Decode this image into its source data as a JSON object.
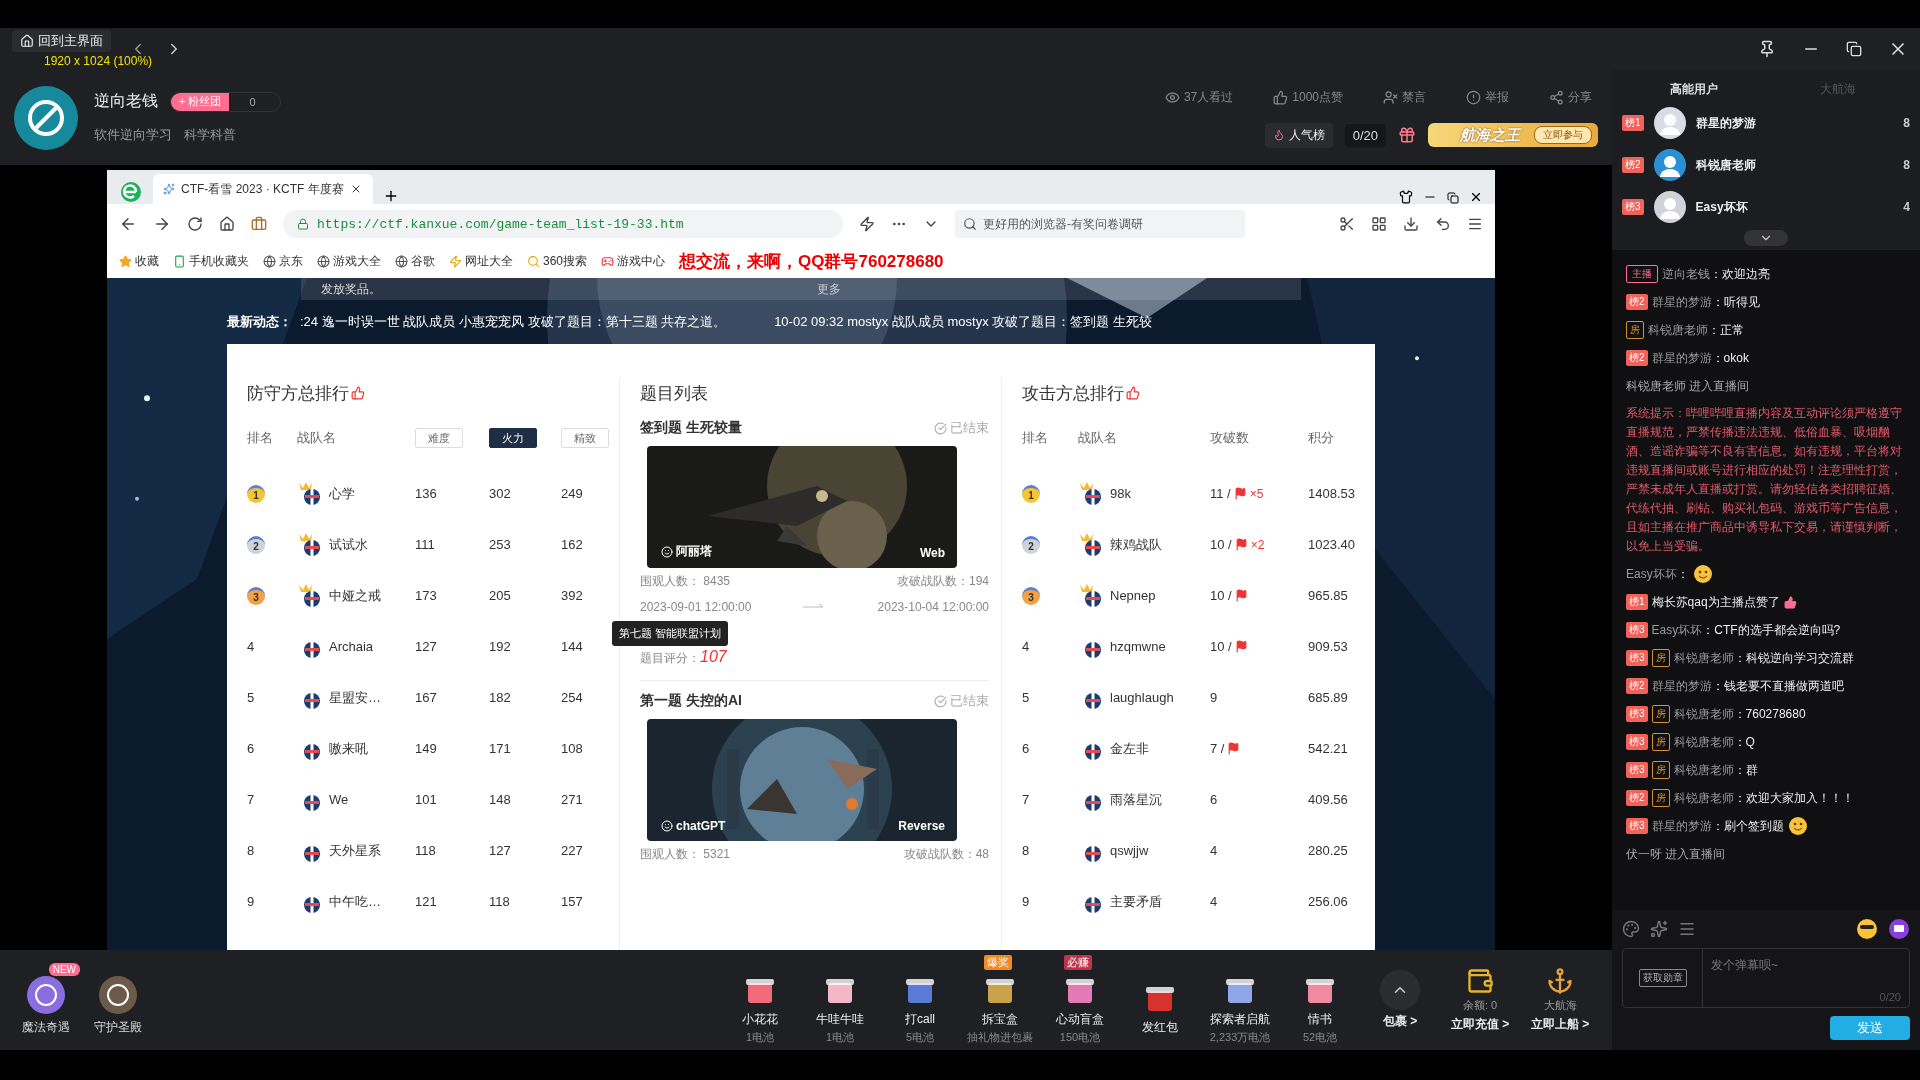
{
  "window": {
    "home_button": "回到主界面",
    "resolution_overlay": "1920 x 1024 (100%)"
  },
  "streamer": {
    "name": "逆向老钱",
    "fan_club": "+ 粉丝团",
    "fan_count": "0",
    "tags": [
      "软件逆向学习",
      "科学科普"
    ],
    "stats": [
      {
        "kind": "views",
        "label": "37人看过"
      },
      {
        "kind": "likes",
        "label": "1000点赞"
      },
      {
        "kind": "mute",
        "label": "禁言"
      },
      {
        "kind": "report",
        "label": "举报"
      },
      {
        "kind": "share",
        "label": "分享"
      }
    ],
    "popularity": "人气榜",
    "progress": "0/20",
    "banner": {
      "title": "航海之王",
      "button": "立即参与"
    }
  },
  "browser": {
    "tab": "CTF-看雪 2023 · KCTF 年度赛",
    "url": "https://ctf.kanxue.com/game-team_list-19-33.htm",
    "search_placeholder": "更好用的浏览器-有奖问卷调研",
    "bookmarks": [
      {
        "kind": "star",
        "label": "收藏"
      },
      {
        "kind": "phone",
        "label": "手机收藏夹"
      },
      {
        "kind": "globe",
        "label": "京东"
      },
      {
        "kind": "globe",
        "label": "游戏大全"
      },
      {
        "kind": "globe",
        "label": "谷歌"
      },
      {
        "kind": "site",
        "label": "网址大全"
      },
      {
        "kind": "search",
        "label": "360搜索"
      },
      {
        "kind": "game",
        "label": "游戏中心"
      }
    ],
    "overlay_text": "想交流，来啊，QQ群号760278680"
  },
  "page": {
    "notice": "发放奖品。",
    "more": "更多",
    "ticker_label": "最新动态：",
    "ticker": [
      ":24 逸一时误一世 战队成员 小惠宠宠风 攻破了题目：第十三题 共存之道。",
      "10-02 09:32 mostyx 战队成员 mostyx 攻破了题目：签到题 生死较"
    ],
    "defense": {
      "title": "防守方总排行",
      "columns": [
        "排名",
        "战队名"
      ],
      "sorts": [
        {
          "label": "难度",
          "selected": false
        },
        {
          "label": "火力",
          "selected": true
        },
        {
          "label": "精致",
          "selected": false
        }
      ],
      "rows": [
        {
          "rank": "1",
          "color": "#f7c531",
          "team": "心学",
          "values": [
            "136",
            "302",
            "249"
          ]
        },
        {
          "rank": "2",
          "color": "#cfd2d6",
          "team": "试试水",
          "values": [
            "111",
            "253",
            "162"
          ]
        },
        {
          "rank": "3",
          "color": "#f4a045",
          "team": "中娅之戒",
          "values": [
            "173",
            "205",
            "392"
          ]
        },
        {
          "rank": "4",
          "team": "Archaia",
          "values": [
            "127",
            "192",
            "144"
          ]
        },
        {
          "rank": "5",
          "team": "星盟安…",
          "values": [
            "167",
            "182",
            "254"
          ]
        },
        {
          "rank": "6",
          "team": "嗷来吼",
          "values": [
            "149",
            "171",
            "108"
          ]
        },
        {
          "rank": "7",
          "team": "We",
          "values": [
            "101",
            "148",
            "271"
          ]
        },
        {
          "rank": "8",
          "team": "天外星系",
          "values": [
            "118",
            "127",
            "227"
          ]
        },
        {
          "rank": "9",
          "team": "中午吃…",
          "values": [
            "121",
            "118",
            "157"
          ]
        }
      ]
    },
    "problems": {
      "title": "题目列表",
      "items": [
        {
          "title": "签到题 生死较量",
          "status": "已结束",
          "author": "阿丽塔",
          "category": "Web",
          "viewers_label": "围观人数：",
          "viewers": "8435",
          "solved_label": "攻破战队数：",
          "solved": "194",
          "start": "2023-09-01 12:00:00",
          "end": "2023-10-04 12:00:00",
          "score_label": "题目评分：",
          "score": "107"
        },
        {
          "title": "第一题 失控的AI",
          "status": "已结束",
          "author": "chatGPT",
          "category": "Reverse",
          "viewers_label": "围观人数：",
          "viewers": "5321",
          "solved_label": "攻破战队数：",
          "solved": "48"
        }
      ]
    },
    "tooltip": "第七题 智能联盟计划",
    "attack": {
      "title": "攻击方总排行",
      "columns": [
        "排名",
        "战队名",
        "攻破数",
        "积分"
      ],
      "rows": [
        {
          "rank": "1",
          "color": "#f7c531",
          "team": "98k",
          "solved": "11 /",
          "flag": true,
          "flag_count": "×5",
          "points": "1408.53"
        },
        {
          "rank": "2",
          "color": "#cfd2d6",
          "team": "辣鸡战队",
          "solved": "10 /",
          "flag": true,
          "flag_count": "×2",
          "points": "1023.40"
        },
        {
          "rank": "3",
          "color": "#f4a045",
          "team": "Nepnep",
          "solved": "10 /",
          "flag": true,
          "points": "965.85"
        },
        {
          "rank": "4",
          "team": "hzqmwne",
          "solved": "10 /",
          "flag": true,
          "points": "909.53"
        },
        {
          "rank": "5",
          "team": "laughlaugh",
          "solved": "9",
          "flag": false,
          "points": "685.89"
        },
        {
          "rank": "6",
          "team": "金左非",
          "solved": "7 /",
          "flag": true,
          "points": "542.21"
        },
        {
          "rank": "7",
          "team": "雨落星沉",
          "solved": "6",
          "flag": false,
          "points": "409.56"
        },
        {
          "rank": "8",
          "team": "qswjjw",
          "solved": "4",
          "flag": false,
          "points": "280.25"
        },
        {
          "rank": "9",
          "team": "主要矛盾",
          "solved": "4",
          "flag": false,
          "points": "256.06"
        }
      ]
    }
  },
  "gift_bar": {
    "left": [
      {
        "label": "魔法奇遇",
        "badge": "NEW"
      },
      {
        "label": "守护圣殿"
      }
    ],
    "gifts": [
      {
        "name": "小花花",
        "price": "1电池"
      },
      {
        "name": "牛哇牛哇",
        "price": "1电池"
      },
      {
        "name": "打call",
        "price": "5电池"
      },
      {
        "name": "拆宝盒",
        "price": "抽礼物进包裹",
        "tag": "爆奖"
      },
      {
        "name": "心动盲盒",
        "price": "150电池",
        "tag": "必赚"
      },
      {
        "name": "发红包"
      },
      {
        "name": "探索者启航",
        "price": "2,233万电池"
      },
      {
        "name": "情书",
        "price": "52电池"
      }
    ],
    "package": "包裹 >",
    "balance": "余额: 0",
    "recharge": "立即充值 >",
    "fleet": "大航海",
    "board": "立即上船 >"
  },
  "side": {
    "tabs": [
      {
        "label": "高能用户",
        "selected": true
      },
      {
        "label": "大航海",
        "selected": false
      }
    ],
    "users": [
      {
        "rank": "榜1",
        "name": "群星的梦游",
        "count": "8"
      },
      {
        "rank": "榜2",
        "name": "科锐唐老师",
        "count": "8"
      },
      {
        "rank": "榜3",
        "name": "Easy坏坏",
        "count": "4"
      }
    ],
    "messages": [
      {
        "kind": "chat",
        "badges": [
          {
            "kind": "host",
            "label": "主播"
          }
        ],
        "user": "逆向老钱",
        "text": "：欢迎边亮"
      },
      {
        "kind": "chat",
        "badges": [
          {
            "kind": "rank",
            "label": "榜2"
          }
        ],
        "user": "群星的梦游",
        "text": "：听得见"
      },
      {
        "kind": "chat",
        "badges": [
          {
            "kind": "admin",
            "label": "房"
          }
        ],
        "user": "科锐唐老师",
        "text": "：正常"
      },
      {
        "kind": "chat",
        "badges": [
          {
            "kind": "rank",
            "label": "榜2"
          }
        ],
        "user": "群星的梦游",
        "text": "：okok"
      },
      {
        "kind": "enter",
        "text": "科锐唐老师 进入直播间"
      },
      {
        "kind": "system",
        "text": "系统提示：哔哩哔哩直播内容及互动评论须严格遵守直播规范，严禁传播违法违规、低俗血暴、吸烟酗酒、造谣诈骗等不良有害信息。如有违规，平台将对违规直播间或账号进行相应的处罚！注意理性打赏，严禁未成年人直播或打赏。请勿轻信各类招聘征婚、代练代抽、刷钻、购买礼包码、游戏币等广告信息，且如主播在推广商品中诱导私下交易，请谨慎判断，以免上当受骗。"
      },
      {
        "kind": "chat",
        "user": "Easy坏坏",
        "text": "：",
        "emoji": true
      },
      {
        "kind": "like",
        "badges": [
          {
            "kind": "rank",
            "label": "榜1"
          }
        ],
        "text": "梅长苏qaq为主播点赞了"
      },
      {
        "kind": "chat",
        "badges": [
          {
            "kind": "rank",
            "label": "榜3"
          }
        ],
        "user": "Easy坏坏",
        "text": "：CTF的选手都会逆向吗?"
      },
      {
        "kind": "chat",
        "badges": [
          {
            "kind": "rank",
            "label": "榜3"
          },
          {
            "kind": "admin",
            "label": "房"
          }
        ],
        "user": "科锐唐老师",
        "text": "：科锐逆向学习交流群"
      },
      {
        "kind": "chat",
        "badges": [
          {
            "kind": "rank",
            "label": "榜2"
          }
        ],
        "user": "群星的梦游",
        "text": "：钱老要不直播做两道吧"
      },
      {
        "kind": "chat",
        "badges": [
          {
            "kind": "rank",
            "label": "榜3"
          },
          {
            "kind": "admin",
            "label": "房"
          }
        ],
        "user": "科锐唐老师",
        "text": "：760278680"
      },
      {
        "kind": "chat",
        "badges": [
          {
            "kind": "rank",
            "label": "榜3"
          },
          {
            "kind": "admin",
            "label": "房"
          }
        ],
        "user": "科锐唐老师",
        "text": "：Q"
      },
      {
        "kind": "chat",
        "badges": [
          {
            "kind": "rank",
            "label": "榜3"
          },
          {
            "kind": "admin",
            "label": "房"
          }
        ],
        "user": "科锐唐老师",
        "text": "：群"
      },
      {
        "kind": "chat",
        "badges": [
          {
            "kind": "rank",
            "label": "榜2"
          },
          {
            "kind": "admin",
            "label": "房"
          }
        ],
        "user": "科锐唐老师",
        "text": "：欢迎大家加入！！！"
      },
      {
        "kind": "chat",
        "badges": [
          {
            "kind": "rank",
            "label": "榜3"
          }
        ],
        "user": "群星的梦游",
        "text": "：刷个签到题",
        "emoji": true
      },
      {
        "kind": "enter",
        "text": "伏一呀 进入直播间"
      }
    ],
    "medal_button": "获取勋章",
    "input_placeholder": "发个弹幕呗~",
    "counter": "0/20",
    "send": "发送"
  }
}
